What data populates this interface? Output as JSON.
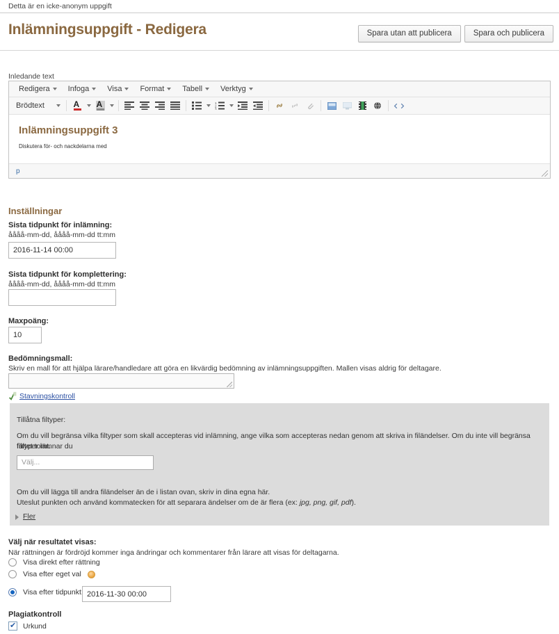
{
  "notice": "Detta är en icke-anonym uppgift",
  "header": {
    "title": "Inlämningsuppgift - Redigera",
    "save_unpublished_label": "Spara utan att publicera",
    "save_publish_label": "Spara och publicera"
  },
  "editor": {
    "label": "Inledande text",
    "menubar": [
      "Redigera",
      "Infoga",
      "Visa",
      "Format",
      "Tabell",
      "Verktyg"
    ],
    "format_select": "Brödtext",
    "content_heading": "Inlämningsuppgift 3",
    "content_paragraph": "Diskutera för- och nackdelarna med",
    "status_path": "p",
    "icons": {
      "text_color": "text-color-icon",
      "background_color": "background-color-icon",
      "align_left": "align-left-icon",
      "align_center": "align-center-icon",
      "align_right": "align-right-icon",
      "align_justify": "align-justify-icon",
      "bullet_list": "bullet-list-icon",
      "numbered_list": "numbered-list-icon",
      "outdent": "outdent-icon",
      "indent": "indent-icon",
      "link": "link-icon",
      "unlink": "unlink-icon",
      "anchor": "anchor-icon",
      "image": "image-icon",
      "screen": "screen-icon",
      "media": "media-icon",
      "globe": "globe-icon",
      "source_code": "source-code-icon"
    }
  },
  "settings": {
    "section_title": "Inställningar",
    "deadline_label": "Sista tidpunkt för inlämning:",
    "deadline_hint": "åååå-mm-dd, åååå-mm-dd tt:mm",
    "deadline_value": "2016-11-14 00:00",
    "completion_label": "Sista tidpunkt för komplettering:",
    "completion_hint": "åååå-mm-dd, åååå-mm-dd tt:mm",
    "completion_value": "",
    "maxpoints_label": "Maxpoäng:",
    "maxpoints_value": "10",
    "rubric_label": "Bedömningsmall:",
    "rubric_hint": "Skriv en mall för att hjälpa lärare/handledare att göra en likvärdig bedömning av inlämningsuppgiften. Mallen visas aldrig för deltagare.",
    "rubric_value": "",
    "spellcheck_label": "Stavningskontroll"
  },
  "filetypes": {
    "title": "Tillåtna filtyper:",
    "description_line1": "Om du vill begränsa vilka filtyper som skall accepteras vid inlämning, ange vilka som accepteras nedan genom att skriva in filändelser. Om du inte vill begränsa filtyper lämnar du",
    "description_line2": "fältet tomt.",
    "select_placeholder": "Välj...",
    "extra_line1": "Om du vill lägga till andra filändelser än de i listan ovan, skriv in dina egna här.",
    "extra_line2_pre": "Uteslut punkten och använd kommatecken för att separara ändelser om de är flera (ex: ",
    "extra_line2_examples": "jpg, png, gif, pdf",
    "extra_line2_post": ").",
    "more_label": "Fler"
  },
  "results": {
    "title": "Välj när resultatet visas:",
    "hint": "När rättningen är fördröjd kommer inga ändringar och kommentarer från lärare att visas för deltagarna.",
    "options": [
      {
        "label": "Visa direkt efter rättning",
        "selected": false
      },
      {
        "label": "Visa efter eget val",
        "selected": false
      },
      {
        "label": "Visa efter tidpunkt:",
        "selected": true
      }
    ],
    "date_value": "2016-11-30 00:00"
  },
  "plagiarism": {
    "title": "Plagiatkontroll",
    "option_label": "Urkund",
    "checked": true
  },
  "colors": {
    "brand": "#8a6840",
    "link": "#2a4fa2",
    "panel": "#dcdcdc"
  }
}
